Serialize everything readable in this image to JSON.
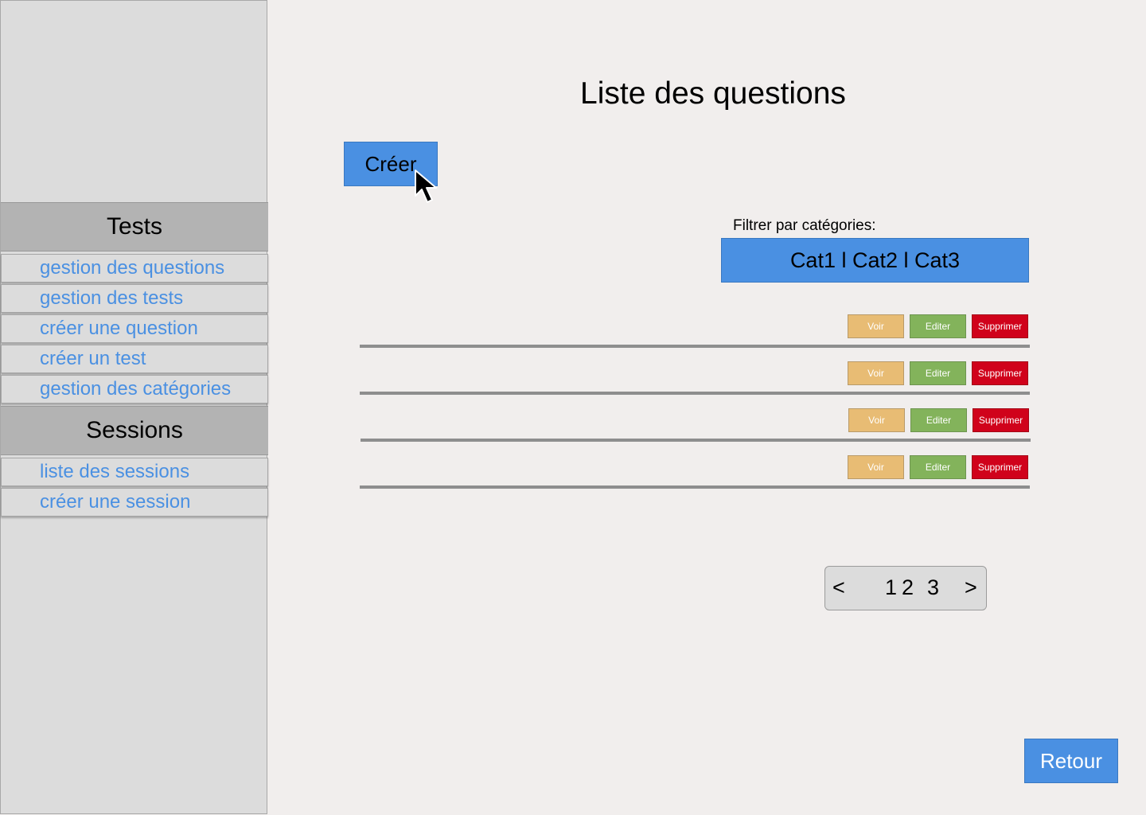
{
  "sidebar": {
    "tests_header": "Tests",
    "tests_items": [
      {
        "label": "gestion des questions"
      },
      {
        "label": "gestion des tests"
      },
      {
        "label": "créer une question"
      },
      {
        "label": "créer un test"
      },
      {
        "label": "gestion des catégories"
      }
    ],
    "sessions_header": "Sessions",
    "sessions_items": [
      {
        "label": "liste des sessions"
      },
      {
        "label": "créer une session"
      }
    ]
  },
  "main": {
    "title": "Liste des questions",
    "create_label": "Créer",
    "filter_label": "Filtrer par catégories:",
    "filter_value": "Cat1 l Cat2 l Cat3",
    "rows": [
      {
        "voir": "Voir",
        "editer": "Editer",
        "supprimer": "Supprimer"
      },
      {
        "voir": "Voir",
        "editer": "Editer",
        "supprimer": "Supprimer"
      },
      {
        "voir": "Voir",
        "editer": "Editer",
        "supprimer": "Supprimer"
      },
      {
        "voir": "Voir",
        "editer": "Editer",
        "supprimer": "Supprimer"
      }
    ],
    "pagination": {
      "prev": "<",
      "pages": [
        "1",
        "2",
        "3"
      ],
      "next": ">"
    },
    "back_label": "Retour"
  },
  "colors": {
    "accent": "#4a90e2",
    "voir": "#e8bc74",
    "editer": "#83b35b",
    "supprimer": "#d0021b",
    "background": "#f1eeed",
    "sidebar": "#dcdcdc"
  },
  "icons": {
    "cursor": "mouse-pointer-icon"
  }
}
